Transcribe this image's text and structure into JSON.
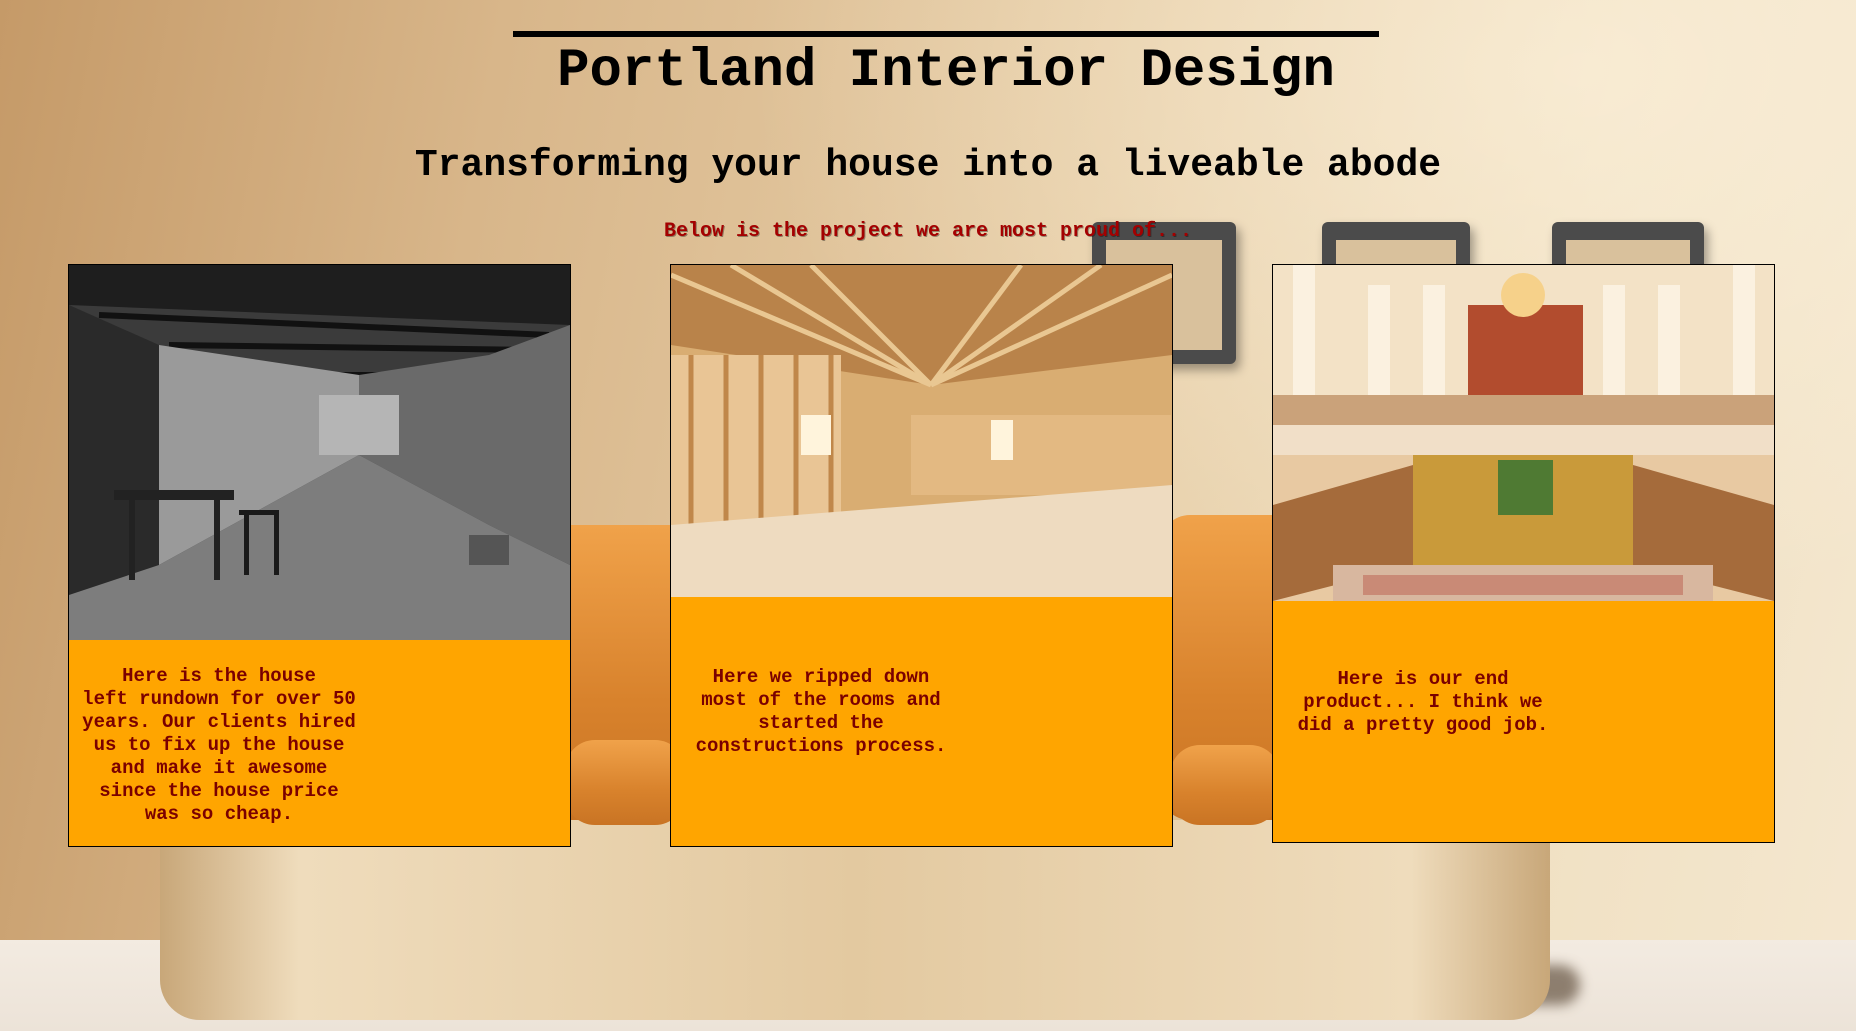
{
  "header": {
    "title": "Portland Interior Design",
    "subtitle": "Transforming your house into a liveable abode"
  },
  "intro": "Below is the project we are most proud of...",
  "cards": [
    {
      "caption": "Here is the house\nleft rundown for over 50\nyears. Our clients hired\nus to fix up the house\nand make it awesome\nsince the house price\nwas so cheap."
    },
    {
      "caption": "Here we ripped down\nmost of the rooms and\nstarted the\nconstructions process."
    },
    {
      "caption": "Here is our end\nproduct... I think we\ndid a pretty good job."
    }
  ],
  "colors": {
    "card_background": "#ffa500",
    "caption_text": "#7a0000",
    "intro_text": "#a40000"
  }
}
